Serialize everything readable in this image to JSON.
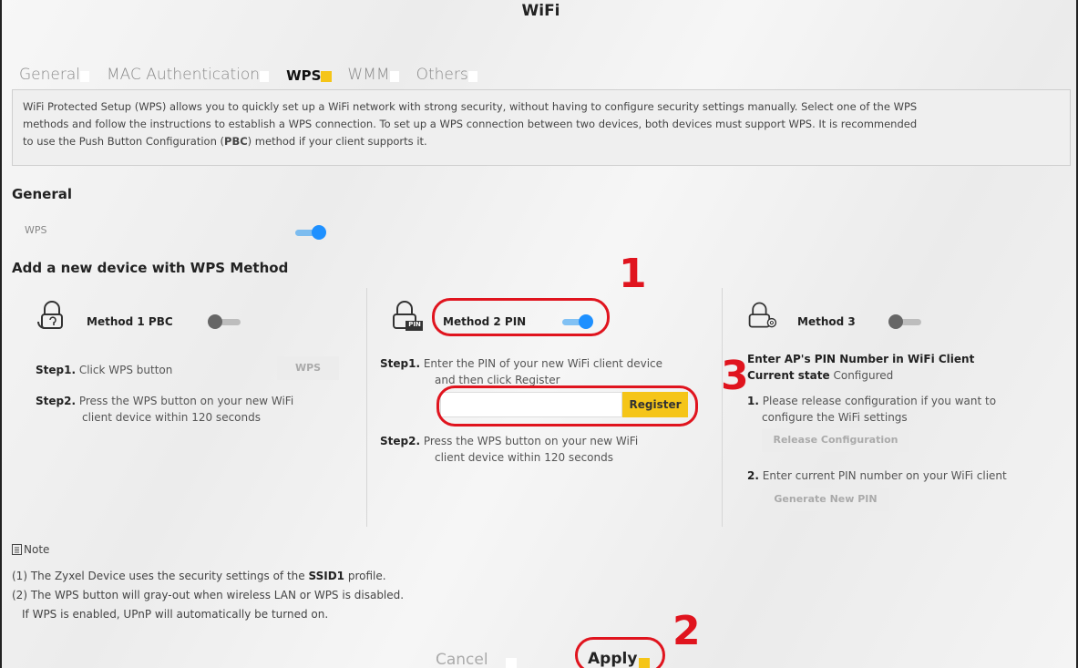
{
  "header": {
    "title": "WiFi"
  },
  "tabs": [
    {
      "label": "General"
    },
    {
      "label": "MAC Authentication"
    },
    {
      "label": "WPS"
    },
    {
      "label": "WMM"
    },
    {
      "label": "Others"
    }
  ],
  "description": {
    "line1": "WiFi Protected Setup (WPS) allows you to quickly set up a WiFi network with strong security, without having to configure security settings manually. Select one of the WPS",
    "line2": "methods and follow the instructions to establish a WPS connection. To set up a WPS connection between two devices, both devices must support WPS. It is recommended",
    "line3_pre": "to use the Push Button Configuration (",
    "line3_bold": "PBC",
    "line3_post": ") method if your client supports it."
  },
  "general": {
    "heading": "General",
    "wps_label": "WPS",
    "wps_enabled": true
  },
  "add_device": {
    "heading": "Add a new device with WPS Method"
  },
  "method1": {
    "label": "Method 1 PBC",
    "enabled": false,
    "step1_label": "Step1.",
    "step1_text": "Click WPS button",
    "wps_button": "WPS",
    "step2_label": "Step2.",
    "step2_line1": "Press the WPS button on your new WiFi",
    "step2_line2": "client device within 120 seconds"
  },
  "method2": {
    "label": "Method 2 PIN",
    "enabled": true,
    "pin_badge": "PIN",
    "step1_label": "Step1.",
    "step1_line1": "Enter the PIN of your new WiFi client device",
    "step1_line2": "and then click Register",
    "pin_value": "",
    "register_button": "Register",
    "step2_label": "Step2.",
    "step2_line1": "Press the WPS button on your new WiFi",
    "step2_line2": "client device within 120 seconds"
  },
  "method3": {
    "label": "Method 3",
    "enabled": false,
    "heading": "Enter AP's PIN Number in WiFi Client",
    "state_label": "Current state",
    "state_value": "Configured",
    "item1_num": "1.",
    "item1_line1": "Please release configuration if you want to",
    "item1_line2": "configure the WiFi settings",
    "release_button": "Release Configuration",
    "item2_num": "2.",
    "item2_text": "Enter current PIN number on your WiFi client",
    "generate_button": "Generate New PIN"
  },
  "note": {
    "title": "Note",
    "line1_pre": "(1) The Zyxel Device uses the security settings of the ",
    "line1_bold": "SSID1",
    "line1_post": " profile.",
    "line2": "(2) The WPS button will gray-out when wireless LAN or WPS is disabled.",
    "line3": "If WPS is enabled, UPnP will automatically be turned on."
  },
  "footer": {
    "cancel": "Cancel",
    "apply": "Apply"
  },
  "callouts": {
    "n1": "1",
    "n2": "2",
    "n3": "3"
  },
  "colors": {
    "accent": "#f5c518",
    "toggle_on": "#1e90ff",
    "callout": "#e0141e"
  }
}
